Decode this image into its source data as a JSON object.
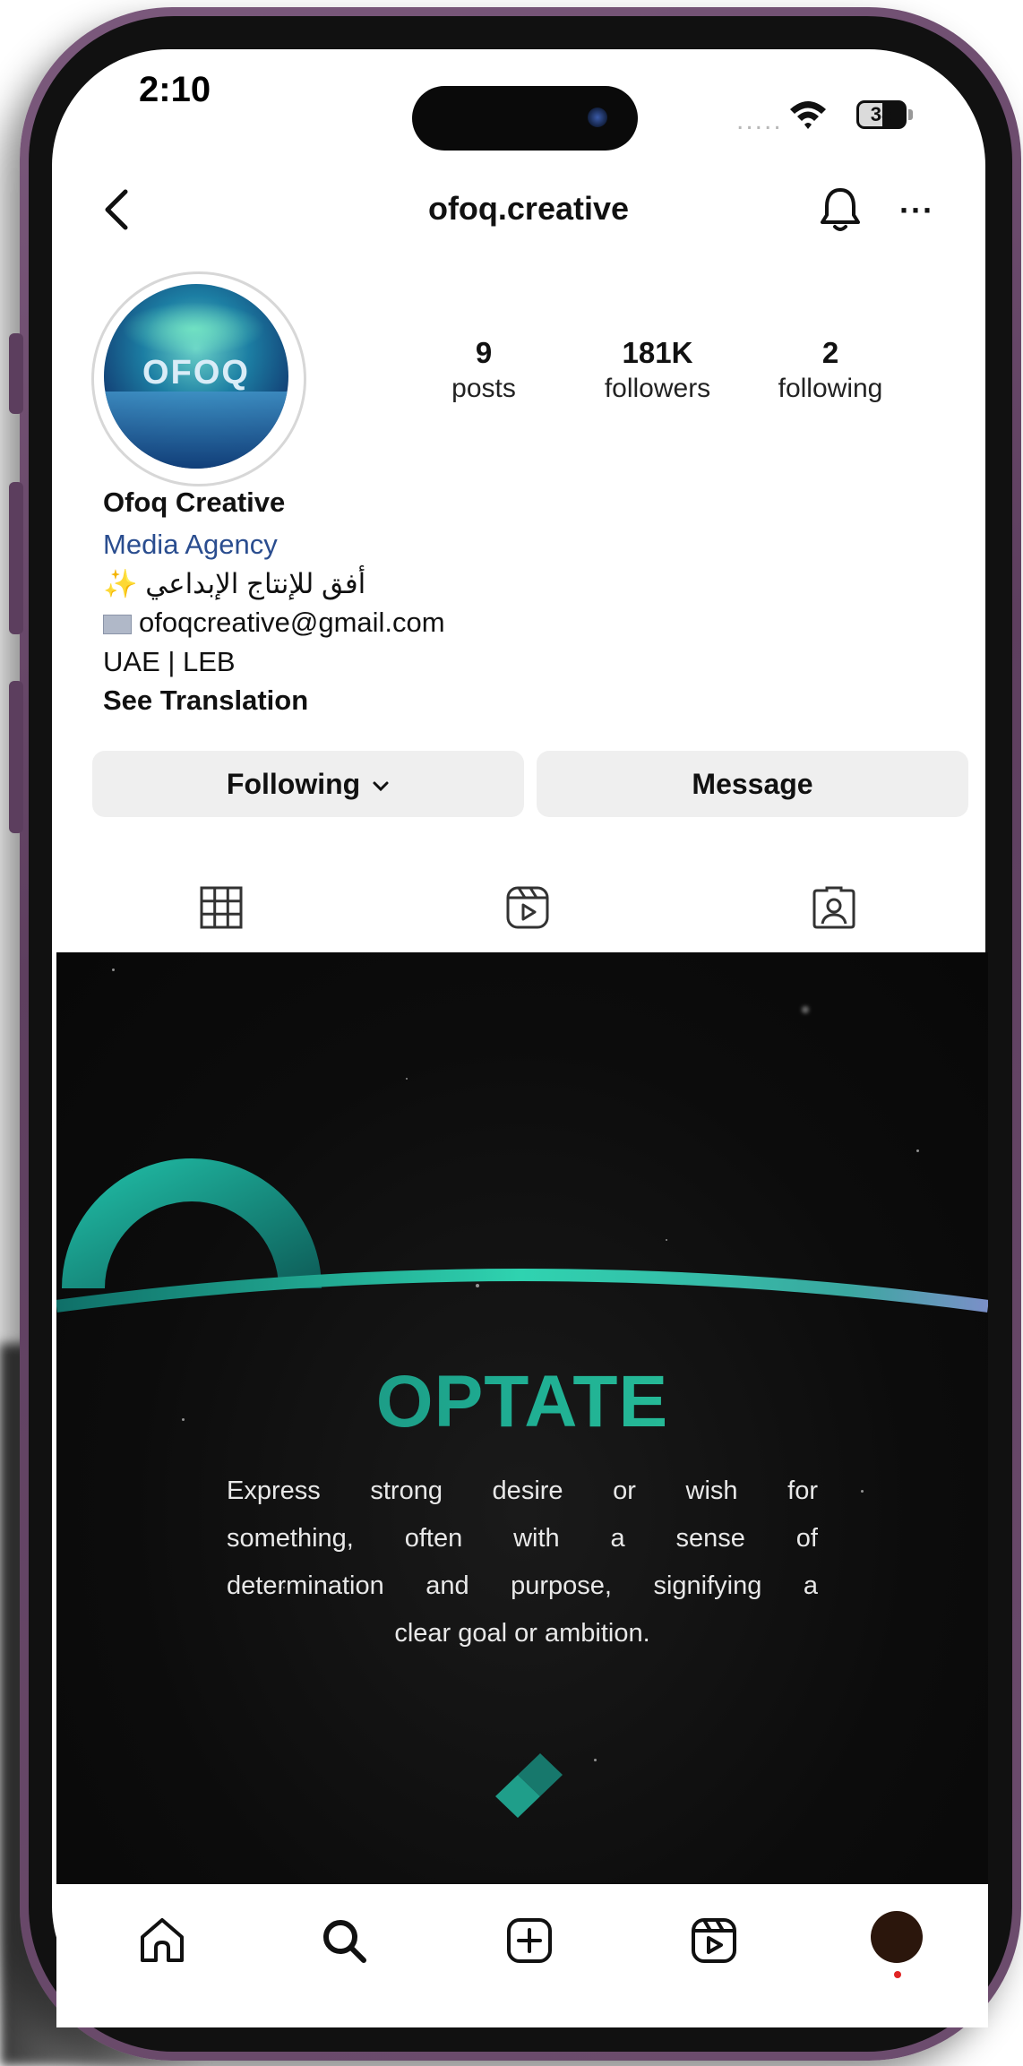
{
  "status_bar": {
    "time": "2:10",
    "signal": ".....",
    "battery": "38"
  },
  "header": {
    "handle": "ofoq.creative"
  },
  "profile": {
    "stats": [
      {
        "value": "9",
        "label": "posts"
      },
      {
        "value": "181K",
        "label": "followers"
      },
      {
        "value": "2",
        "label": "following"
      }
    ],
    "name": "Ofoq Creative",
    "category": "Media Agency",
    "bio_arabic": "أفق للإنتاج الإبداعي",
    "bio_sparkle": "✨",
    "email": "ofoqcreative@gmail.com",
    "location": "UAE | LEB",
    "see_translation": "See Translation",
    "avatar_text": "OFOQ"
  },
  "actions": {
    "following": "Following",
    "message": "Message"
  },
  "post": {
    "title": "OPTATE",
    "lines": [
      "Express strong desire or wish for",
      "something, often with a sense of",
      "determination and purpose, signifying a",
      "clear goal or ambition."
    ]
  },
  "colors": {
    "accent_teal": "#1f9e8a",
    "phone_frame": "#6d4d6e",
    "link_blue": "#2a4d8f"
  }
}
